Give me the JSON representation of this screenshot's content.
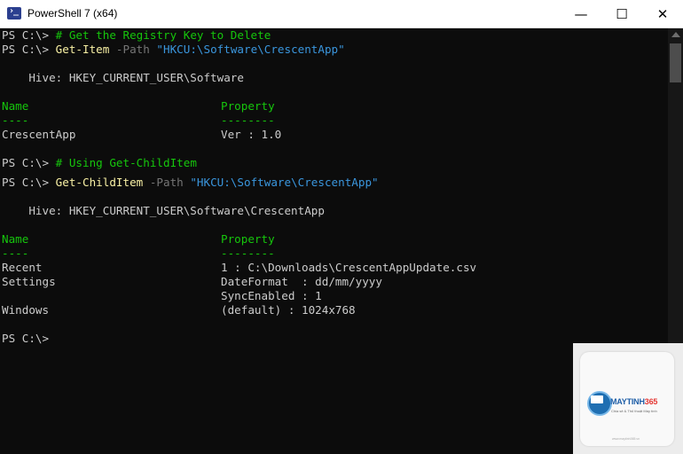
{
  "window": {
    "title": "PowerShell 7 (x64)",
    "buttons": {
      "minimize": "—",
      "maximize": "☐",
      "close": "✕"
    }
  },
  "terminal": {
    "prompt": "PS C:\\> ",
    "l1_comment": "# Get the Registry Key to Delete",
    "l2_cmd": "Get-Item",
    "l2_param": " -Path ",
    "l2_arg": "\"HKCU:\\Software\\CrescentApp\"",
    "l3_hive": "    Hive: HKEY_CURRENT_USER\\Software",
    "name_header": "Name",
    "property_header": "Property",
    "name_sep": "----",
    "property_sep": "--------",
    "r1_name": "CrescentApp",
    "r1_prop": "Ver : 1.0",
    "l4_comment": "# Using Get-ChildItem",
    "l5_cmd": "Get-ChildItem",
    "l5_param": " -Path ",
    "l5_arg": "\"HKCU:\\Software\\CrescentApp\"",
    "l6_hive": "    Hive: HKEY_CURRENT_USER\\Software\\CrescentApp",
    "r2_name": "Recent",
    "r2_prop": "1 : C:\\Downloads\\CrescentAppUpdate.csv",
    "r3_name": "Settings",
    "r3_prop": "DateFormat  : dd/mm/yyyy",
    "r3_prop2": "SyncEnabled : 1",
    "r4_name": "Windows",
    "r4_prop": "(default) : 1024x768",
    "final_prompt": "PS C:\\>"
  },
  "watermark": {
    "brand": "MAYTINH",
    "brand_num": "365",
    "tagline": "Chia sẻ & Thủ thuật Máy tính",
    "url": "www.maytinh365.vn"
  },
  "colors": {
    "background": "#0c0c0c",
    "text": "#cccccc",
    "comment": "#16c60c",
    "cmdlet": "#f9f1a5",
    "parameter": "#767676",
    "string": "#3a96dd"
  }
}
